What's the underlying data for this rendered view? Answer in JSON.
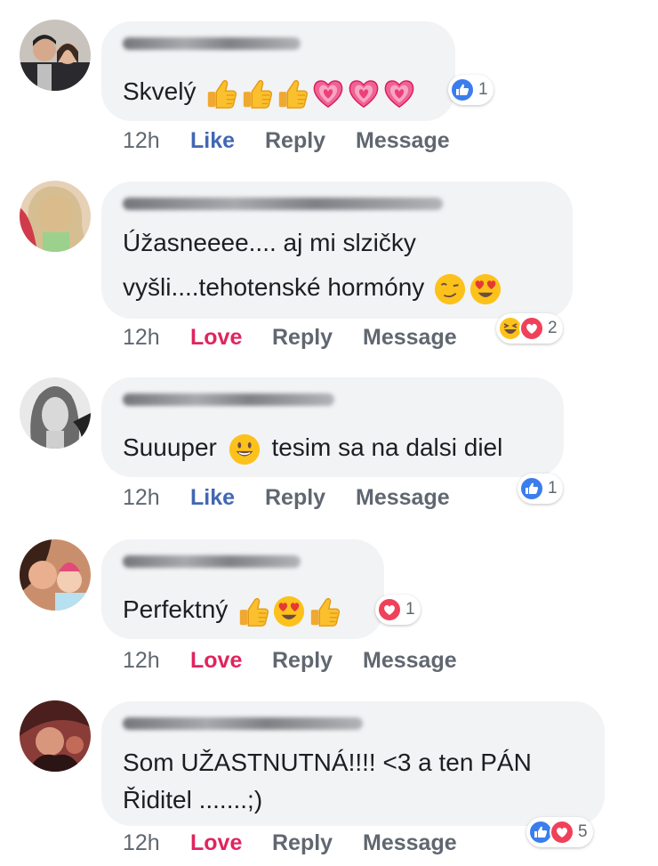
{
  "comments": [
    {
      "text": "Skvelý",
      "emojis": [
        "thumbs-up",
        "thumbs-up",
        "thumbs-up",
        "heart",
        "heart",
        "heart"
      ],
      "time": "12h",
      "reaction_label": "Like",
      "reply": "Reply",
      "message": "Message",
      "reaction_icons": [
        "like"
      ],
      "reaction_count": "1"
    },
    {
      "text_line1": "Úžasneeee.... aj mi slzičky",
      "text_line2": "vyšli....tehotenské hormóny",
      "emojis": [
        "wink",
        "heart-eyes"
      ],
      "time": "12h",
      "reaction_label": "Love",
      "reply": "Reply",
      "message": "Message",
      "reaction_icons": [
        "haha",
        "love"
      ],
      "reaction_count": "2"
    },
    {
      "text_before": "Suuuper",
      "text_after": "tesim sa na dalsi diel",
      "emojis": [
        "smile"
      ],
      "time": "12h",
      "reaction_label": "Like",
      "reply": "Reply",
      "message": "Message",
      "reaction_icons": [
        "like"
      ],
      "reaction_count": "1"
    },
    {
      "text": "Perfektný",
      "emojis": [
        "thumbs-up",
        "heart-eyes",
        "thumbs-up"
      ],
      "time": "12h",
      "reaction_label": "Love",
      "reply": "Reply",
      "message": "Message",
      "reaction_icons": [
        "love"
      ],
      "reaction_count": "1"
    },
    {
      "text_line1": "Som UŽASTNUTNÁ!!!! <3 a ten PÁN",
      "text_line2": "Řiditel .......;)",
      "time": "12h",
      "reaction_label": "Love",
      "reply": "Reply",
      "message": "Message",
      "reaction_icons": [
        "like",
        "love"
      ],
      "reaction_count": "5"
    }
  ],
  "colors": {
    "like": "#4267b2",
    "love": "#e0245e",
    "bubble": "#f2f3f5",
    "meta": "#606770"
  }
}
